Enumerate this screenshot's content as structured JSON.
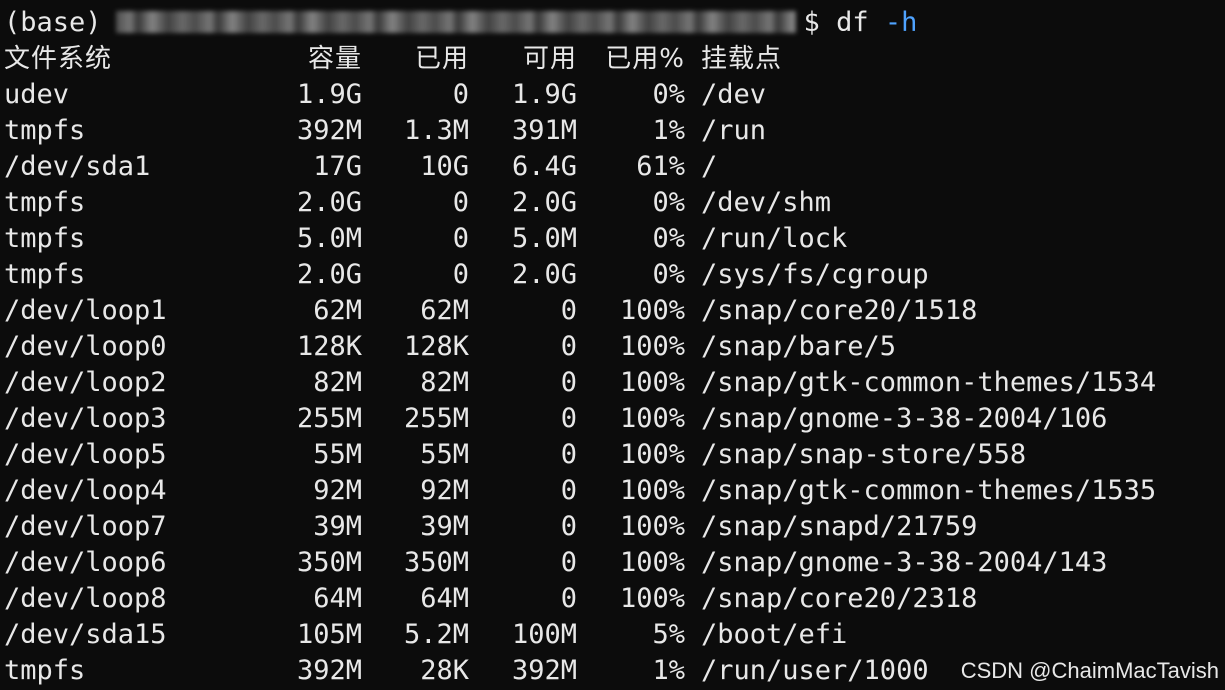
{
  "prompt": {
    "env": "(base)",
    "command": "df",
    "flag": "-h"
  },
  "headers": {
    "filesystem": "文件系统",
    "size": "容量",
    "used": "已用",
    "avail": "可用",
    "use_pct": "已用%",
    "mount": "挂载点"
  },
  "rows": [
    {
      "fs": "udev",
      "size": "1.9G",
      "used": "0",
      "avail": "1.9G",
      "pct": "0%",
      "mount": "/dev"
    },
    {
      "fs": "tmpfs",
      "size": "392M",
      "used": "1.3M",
      "avail": "391M",
      "pct": "1%",
      "mount": "/run"
    },
    {
      "fs": "/dev/sda1",
      "size": "17G",
      "used": "10G",
      "avail": "6.4G",
      "pct": "61%",
      "mount": "/"
    },
    {
      "fs": "tmpfs",
      "size": "2.0G",
      "used": "0",
      "avail": "2.0G",
      "pct": "0%",
      "mount": "/dev/shm"
    },
    {
      "fs": "tmpfs",
      "size": "5.0M",
      "used": "0",
      "avail": "5.0M",
      "pct": "0%",
      "mount": "/run/lock"
    },
    {
      "fs": "tmpfs",
      "size": "2.0G",
      "used": "0",
      "avail": "2.0G",
      "pct": "0%",
      "mount": "/sys/fs/cgroup"
    },
    {
      "fs": "/dev/loop1",
      "size": "62M",
      "used": "62M",
      "avail": "0",
      "pct": "100%",
      "mount": "/snap/core20/1518"
    },
    {
      "fs": "/dev/loop0",
      "size": "128K",
      "used": "128K",
      "avail": "0",
      "pct": "100%",
      "mount": "/snap/bare/5"
    },
    {
      "fs": "/dev/loop2",
      "size": "82M",
      "used": "82M",
      "avail": "0",
      "pct": "100%",
      "mount": "/snap/gtk-common-themes/1534"
    },
    {
      "fs": "/dev/loop3",
      "size": "255M",
      "used": "255M",
      "avail": "0",
      "pct": "100%",
      "mount": "/snap/gnome-3-38-2004/106"
    },
    {
      "fs": "/dev/loop5",
      "size": "55M",
      "used": "55M",
      "avail": "0",
      "pct": "100%",
      "mount": "/snap/snap-store/558"
    },
    {
      "fs": "/dev/loop4",
      "size": "92M",
      "used": "92M",
      "avail": "0",
      "pct": "100%",
      "mount": "/snap/gtk-common-themes/1535"
    },
    {
      "fs": "/dev/loop7",
      "size": "39M",
      "used": "39M",
      "avail": "0",
      "pct": "100%",
      "mount": "/snap/snapd/21759"
    },
    {
      "fs": "/dev/loop6",
      "size": "350M",
      "used": "350M",
      "avail": "0",
      "pct": "100%",
      "mount": "/snap/gnome-3-38-2004/143"
    },
    {
      "fs": "/dev/loop8",
      "size": "64M",
      "used": "64M",
      "avail": "0",
      "pct": "100%",
      "mount": "/snap/core20/2318"
    },
    {
      "fs": "/dev/sda15",
      "size": "105M",
      "used": "5.2M",
      "avail": "100M",
      "pct": "5%",
      "mount": "/boot/efi"
    },
    {
      "fs": "tmpfs",
      "size": "392M",
      "used": "28K",
      "avail": "392M",
      "pct": "1%",
      "mount": "/run/user/1000"
    }
  ],
  "watermark": "CSDN @ChaimMacTavish",
  "colors": {
    "background": "#0c0c0c",
    "text": "#e8e8e8",
    "flag": "#4fa3ff"
  }
}
